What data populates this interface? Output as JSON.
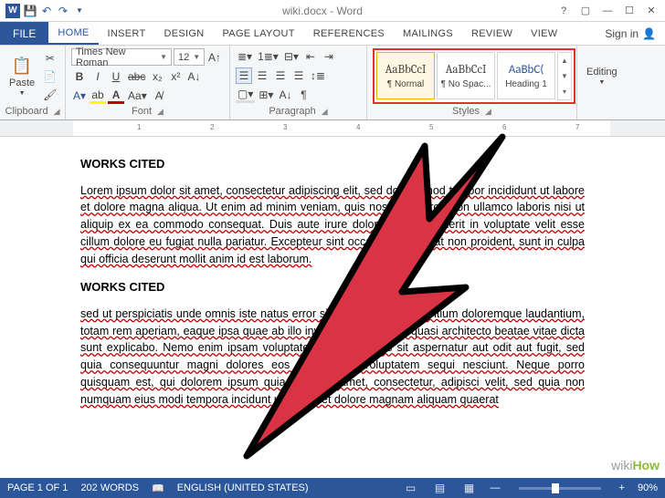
{
  "title": "wiki.docx - Word",
  "tabs": {
    "file": "FILE",
    "home": "HOME",
    "insert": "INSERT",
    "design": "DESIGN",
    "pagelayout": "PAGE LAYOUT",
    "references": "REFERENCES",
    "mailings": "MAILINGS",
    "review": "REVIEW",
    "view": "VIEW"
  },
  "signin": "Sign in",
  "clipboard": {
    "label": "Clipboard",
    "paste": "Paste"
  },
  "font": {
    "label": "Font",
    "name": "Times New Roman",
    "size": "12"
  },
  "paragraph": {
    "label": "Paragraph"
  },
  "styles": {
    "label": "Styles",
    "items": [
      {
        "preview": "AaBbCcI",
        "name": "¶ Normal"
      },
      {
        "preview": "AaBbCcI",
        "name": "¶ No Spac..."
      },
      {
        "preview": "AaBbC(",
        "name": "Heading 1",
        "blue": true
      }
    ]
  },
  "editing": {
    "label": "Editing"
  },
  "ruler": {
    "ticks": [
      "1",
      "2",
      "3",
      "4",
      "5",
      "6",
      "7"
    ]
  },
  "doc": {
    "h1": "WORKS CITED",
    "p1": "Lorem ipsum dolor sit amet, consectetur adipiscing elit, sed do eiusmod tempor incididunt ut labore et dolore magna aliqua. Ut enim ad minim veniam, quis nostrud exercitation ullamco laboris nisi ut aliquip ex ea commodo consequat. Duis aute irure dolor in reprehenderit in voluptate velit esse cillum dolore eu fugiat nulla pariatur. Excepteur sint occaecat cupidatat non proident, sunt in culpa qui officia deserunt mollit anim id est laborum.",
    "h2": "WORKS CITED",
    "p2": "sed ut perspiciatis unde omnis iste natus error sit voluptatem accusantium doloremque laudantium, totam rem aperiam, eaque ipsa quae ab illo inventore veritatis et quasi architecto beatae vitae dicta sunt explicabo. Nemo enim ipsam voluptatem quia voluptas sit aspernatur aut odit aut fugit, sed quia consequuntur magni dolores eos qui ratione voluptatem sequi nesciunt. Neque porro quisquam est, qui dolorem ipsum quia dolor sit amet, consectetur, adipisci velit, sed quia non numquam eius modi tempora incidunt ut labore et dolore magnam aliquam quaerat"
  },
  "status": {
    "page": "PAGE 1 OF 1",
    "words": "202 WORDS",
    "lang": "ENGLISH (UNITED STATES)",
    "zoom": "90%"
  },
  "watermark": "wikiHow"
}
